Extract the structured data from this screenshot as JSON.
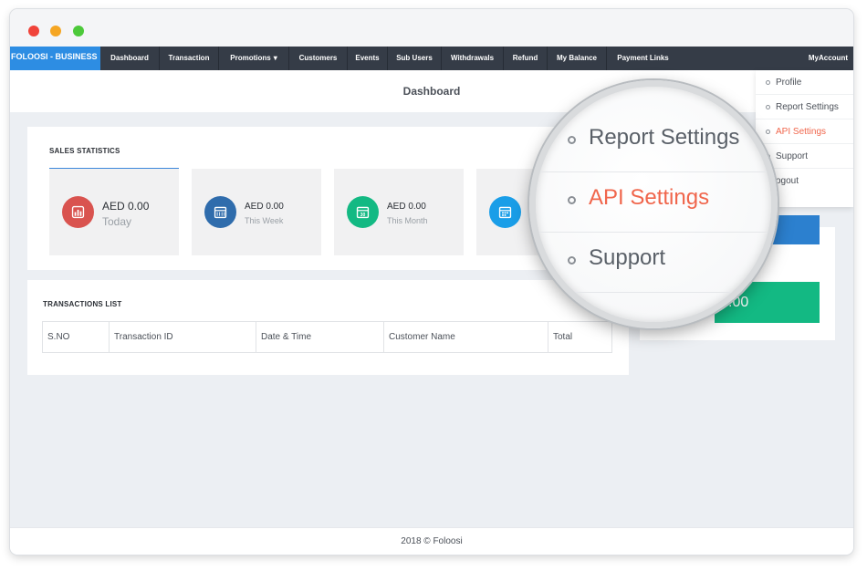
{
  "window": {
    "controls": [
      "close",
      "minimize",
      "maximize"
    ]
  },
  "navbar": {
    "brand": "FOLOOSI - BUSINESS",
    "items": [
      {
        "label": "Dashboard"
      },
      {
        "label": "Transaction"
      },
      {
        "label": "Promotions"
      },
      {
        "label": "Customers"
      },
      {
        "label": "Events"
      },
      {
        "label": "Sub Users"
      },
      {
        "label": "Withdrawals"
      },
      {
        "label": "Refund"
      },
      {
        "label": "My Balance"
      },
      {
        "label": "Payment Links"
      }
    ],
    "account": "MyAccount"
  },
  "page": {
    "title": "Dashboard"
  },
  "sales": {
    "title": "SALES STATISTICS",
    "stats": [
      {
        "value": "AED 0.00",
        "label": "Today",
        "icon": "bar-chart-icon",
        "color": "#d9534f"
      },
      {
        "value": "AED 0.00",
        "label": "This Week",
        "icon": "calendar-week-icon",
        "color": "#2f6cac"
      },
      {
        "value": "AED 0.00",
        "label": "This Month",
        "icon": "calendar-30-icon",
        "color": "#13b983"
      },
      {
        "value": "",
        "label": "",
        "icon": "calendar-icon",
        "color": "#1a9ee8"
      }
    ]
  },
  "transactions": {
    "title": "TRANSACTIONS LIST",
    "columns": [
      "S.NO",
      "Transaction ID",
      "Date & Time",
      "Customer Name",
      "Total"
    ]
  },
  "right_panel": {
    "green_value": ".00"
  },
  "dropdown": {
    "items": [
      {
        "label": "Profile"
      },
      {
        "label": "Report Settings"
      },
      {
        "label": "API Settings"
      },
      {
        "label": "Support"
      },
      {
        "label": "ogout"
      }
    ]
  },
  "magnifier": {
    "items": [
      "Report Settings",
      "API Settings",
      "Support"
    ]
  },
  "footer": {
    "text": "2018 © Foloosi"
  },
  "colors": {
    "accent": "#2d8de3",
    "navbar": "#353c47",
    "active": "#f0664c",
    "green": "#13b983"
  }
}
